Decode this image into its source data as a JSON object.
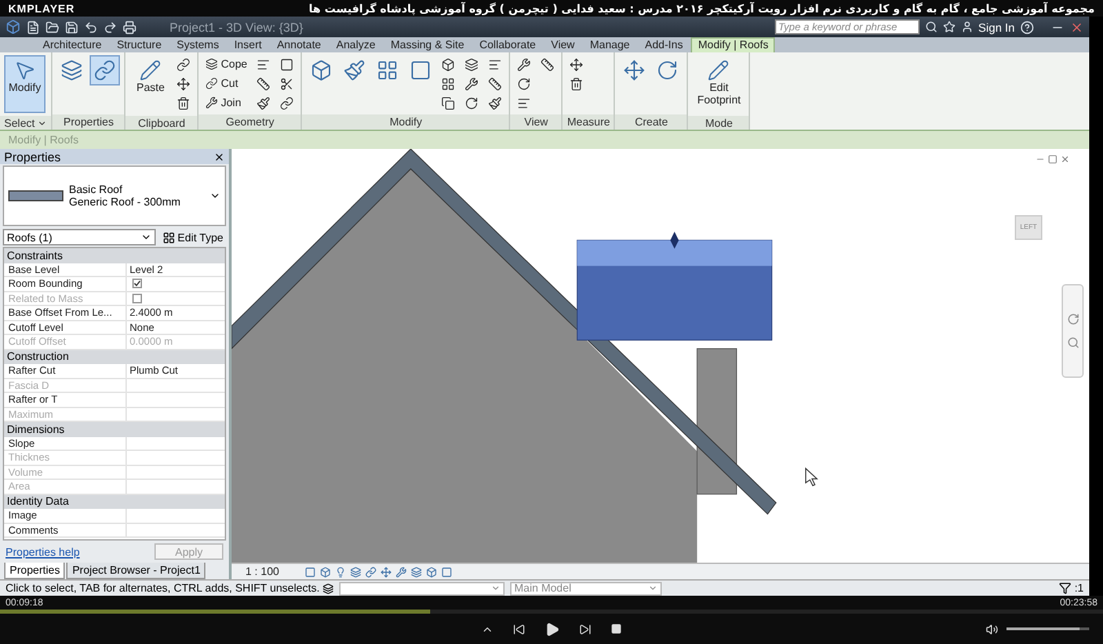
{
  "player": {
    "name": "KMPLAYER",
    "title": "مجموعه آموزشی جامع ، گام به گام و کاربردی نرم افزار رویت آرکیتکچر ۲۰۱۶   مدرس : سعید فدایی ( تیچرمن ) گروه آموزشی پادشاه گرافیست ها",
    "elapsed": "00:09:18",
    "duration": "00:23:58",
    "progress": {
      "level": 0.39
    },
    "volume": {
      "level": 0.88
    }
  },
  "app": {
    "project_title": "Project1 - 3D View: {3D}",
    "search": {
      "placeholder": "Type a keyword or phrase"
    },
    "sign_in": "Sign In"
  },
  "tabs": [
    {
      "label": "Architecture",
      "selected": false
    },
    {
      "label": "Structure",
      "selected": false
    },
    {
      "label": "Systems",
      "selected": false
    },
    {
      "label": "Insert",
      "selected": false
    },
    {
      "label": "Annotate",
      "selected": false
    },
    {
      "label": "Analyze",
      "selected": false
    },
    {
      "label": "Massing & Site",
      "selected": false
    },
    {
      "label": "Collaborate",
      "selected": false
    },
    {
      "label": "View",
      "selected": false
    },
    {
      "label": "Manage",
      "selected": false
    },
    {
      "label": "Add-Ins",
      "selected": false
    },
    {
      "label": "Modify | Roofs",
      "selected": true
    }
  ],
  "ribbon_panels": [
    {
      "title": "Select",
      "menu": true,
      "tools": [
        {
          "kind": "large",
          "label": "Modify",
          "selected": true
        }
      ]
    },
    {
      "title": "Properties",
      "menu": false,
      "tools": [
        {
          "kind": "big-icon",
          "selected": false
        },
        {
          "kind": "big-icon",
          "selected": true
        }
      ]
    },
    {
      "title": "Clipboard",
      "menu": false,
      "tools": [
        {
          "kind": "large",
          "label": "Paste",
          "selected": false
        },
        {
          "kind": "icon",
          "selected": false
        },
        {
          "kind": "icon",
          "selected": false
        },
        {
          "kind": "icon",
          "selected": false
        }
      ]
    },
    {
      "title": "Geometry",
      "menu": false,
      "tools": [
        {
          "kind": "small",
          "label": "Cope",
          "selected": false
        },
        {
          "kind": "small",
          "label": "Cut",
          "selected": false
        },
        {
          "kind": "small",
          "label": "Join",
          "selected": false
        },
        {
          "kind": "icon",
          "selected": false
        },
        {
          "kind": "icon",
          "selected": false
        },
        {
          "kind": "icon",
          "selected": false
        },
        {
          "kind": "icon",
          "selected": false
        },
        {
          "kind": "icon",
          "selected": false
        },
        {
          "kind": "icon",
          "selected": false
        }
      ]
    },
    {
      "title": "Modify",
      "menu": false,
      "tools": [
        {
          "kind": "big-icon",
          "selected": false
        },
        {
          "kind": "big-icon",
          "selected": false
        },
        {
          "kind": "big-icon",
          "selected": false
        },
        {
          "kind": "big-icon",
          "selected": false
        },
        {
          "kind": "icon",
          "selected": false
        },
        {
          "kind": "icon",
          "selected": false
        },
        {
          "kind": "icon",
          "selected": false
        },
        {
          "kind": "icon",
          "selected": false
        },
        {
          "kind": "icon",
          "selected": false
        },
        {
          "kind": "icon",
          "selected": false
        },
        {
          "kind": "icon",
          "selected": false
        },
        {
          "kind": "icon",
          "selected": false
        },
        {
          "kind": "icon",
          "selected": false
        }
      ]
    },
    {
      "title": "View",
      "menu": false,
      "tools": [
        {
          "kind": "icon",
          "selected": false
        },
        {
          "kind": "icon",
          "selected": false
        },
        {
          "kind": "icon",
          "selected": false
        },
        {
          "kind": "icon",
          "selected": false
        }
      ]
    },
    {
      "title": "Measure",
      "menu": false,
      "tools": [
        {
          "kind": "icon",
          "selected": false
        },
        {
          "kind": "icon",
          "selected": false
        }
      ]
    },
    {
      "title": "Create",
      "menu": false,
      "tools": [
        {
          "kind": "big-icon",
          "selected": false
        },
        {
          "kind": "big-icon",
          "selected": false
        }
      ]
    },
    {
      "title": "Mode",
      "menu": false,
      "tools": [
        {
          "kind": "large",
          "label": "Edit Footprint",
          "selected": false
        }
      ]
    }
  ],
  "options_bar": "Modify | Roofs",
  "properties": {
    "title": "Properties",
    "type_name": "Basic Roof",
    "type_sub": "Generic Roof - 300mm",
    "filter": "Roofs (1)",
    "edit_type": "Edit Type",
    "groups": [
      {
        "name": "Constraints",
        "rows": [
          {
            "kind": "text",
            "label": "Base Level",
            "value": "Level 2",
            "disabled": false
          },
          {
            "kind": "checkbox",
            "label": "Room Bounding",
            "checked": true,
            "disabled": false
          },
          {
            "kind": "checkbox",
            "label": "Related to Mass",
            "checked": false,
            "disabled": true
          },
          {
            "kind": "text",
            "label": "Base Offset From Le...",
            "value": "2.4000 m",
            "disabled": false
          },
          {
            "kind": "text",
            "label": "Cutoff Level",
            "value": "None",
            "disabled": false
          },
          {
            "kind": "text",
            "label": "Cutoff Offset",
            "value": "0.0000 m",
            "disabled": true
          }
        ]
      },
      {
        "name": "Construction",
        "rows": [
          {
            "kind": "text",
            "label": "Rafter Cut",
            "value": "Plumb Cut",
            "disabled": false
          },
          {
            "kind": "text",
            "label": "Fascia D",
            "disabled": true
          },
          {
            "kind": "text",
            "label": "Rafter or T",
            "disabled": false
          },
          {
            "kind": "text",
            "label": "Maximum",
            "disabled": true
          }
        ]
      },
      {
        "name": "Dimensions",
        "rows": [
          {
            "kind": "text",
            "label": "Slope",
            "disabled": false
          },
          {
            "kind": "text",
            "label": "Thicknes",
            "disabled": true
          },
          {
            "kind": "text",
            "label": "Volume",
            "disabled": true
          },
          {
            "kind": "text",
            "label": "Area",
            "disabled": true
          }
        ]
      },
      {
        "name": "Identity Data",
        "rows": [
          {
            "kind": "text",
            "label": "Image",
            "disabled": false
          },
          {
            "kind": "text",
            "label": "Comments",
            "disabled": false
          }
        ]
      }
    ],
    "help": "Properties help",
    "apply": "Apply"
  },
  "panel_tabs": [
    {
      "label": "Properties",
      "selected": true
    },
    {
      "label": "Project Browser - Project1",
      "selected": false
    }
  ],
  "viewcube": "LEFT",
  "view_bar": {
    "scale": "1 : 100"
  },
  "status_bar": {
    "message": "Click to select, TAB for alternates, CTRL adds, SHIFT unselects.",
    "model": "Main Model",
    "filter_count": ":1"
  }
}
